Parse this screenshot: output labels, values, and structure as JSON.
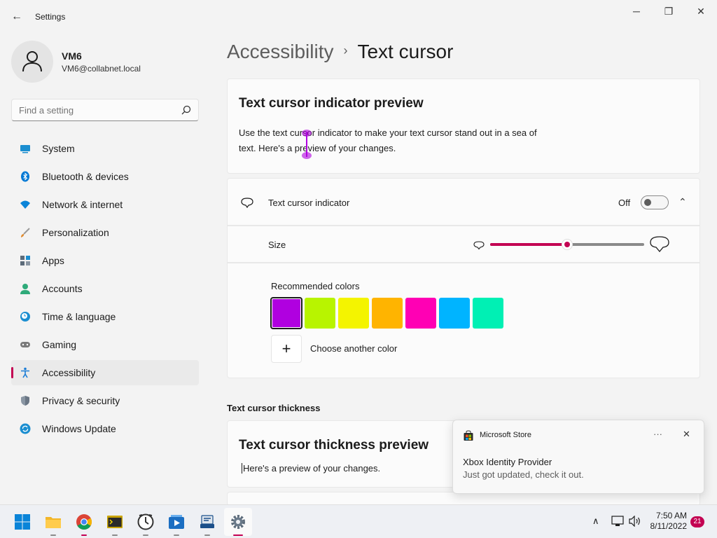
{
  "window": {
    "title": "Settings",
    "back": "←",
    "minimize": "─",
    "maximize": "❐",
    "close": "✕"
  },
  "profile": {
    "name": "VM6",
    "email": "VM6@collabnet.local"
  },
  "search": {
    "placeholder": "Find a setting"
  },
  "nav": [
    {
      "label": "System",
      "icon": "system-icon",
      "color": "#0078d4"
    },
    {
      "label": "Bluetooth & devices",
      "icon": "bluetooth-icon",
      "color": "#0078d4"
    },
    {
      "label": "Network & internet",
      "icon": "wifi-icon",
      "color": "#0a84d8"
    },
    {
      "label": "Personalization",
      "icon": "brush-icon",
      "color": "#e08a2e"
    },
    {
      "label": "Apps",
      "icon": "apps-icon",
      "color": "#5c6b7a"
    },
    {
      "label": "Accounts",
      "icon": "person-icon",
      "color": "#2eaa79"
    },
    {
      "label": "Time & language",
      "icon": "clock-globe-icon",
      "color": "#1b8ed0"
    },
    {
      "label": "Gaming",
      "icon": "gamepad-icon",
      "color": "#7a7a7a"
    },
    {
      "label": "Accessibility",
      "icon": "accessibility-icon",
      "color": "#1b7dd6",
      "active": true
    },
    {
      "label": "Privacy & security",
      "icon": "shield-icon",
      "color": "#7a8694"
    },
    {
      "label": "Windows Update",
      "icon": "update-icon",
      "color": "#1b8ed0"
    }
  ],
  "breadcrumb": {
    "parent": "Accessibility",
    "separator": "›",
    "current": "Text cursor"
  },
  "preview_card": {
    "title": "Text cursor indicator preview",
    "text": "Use the text cursor indicator to make your text cursor stand out in a sea of text. Here's a preview of your changes."
  },
  "indicator": {
    "label": "Text cursor indicator",
    "state": "Off",
    "collapse_glyph": "⌃"
  },
  "size": {
    "label": "Size",
    "value": 0.5
  },
  "colors": {
    "label": "Recommended colors",
    "swatches": [
      "#b000e0",
      "#b8f400",
      "#f4f400",
      "#ffb400",
      "#ff00b4",
      "#00b4ff",
      "#00f0b4"
    ],
    "selected_index": 0,
    "add_glyph": "+",
    "add_label": "Choose another color"
  },
  "thickness": {
    "section_title": "Text cursor thickness",
    "card_title": "Text cursor thickness preview",
    "text": "Here's a preview of your changes."
  },
  "toast": {
    "app": "Microsoft Store",
    "more": "···",
    "close": "✕",
    "title": "Xbox Identity Provider",
    "body": "Just got updated, check it out."
  },
  "taskbar": {
    "apps": [
      {
        "name": "start-icon"
      },
      {
        "name": "file-explorer-icon"
      },
      {
        "name": "chrome-icon",
        "running": true
      },
      {
        "name": "terminal-icon",
        "running": true
      },
      {
        "name": "clock-app-icon",
        "running": true
      },
      {
        "name": "media-player-icon",
        "running": true
      },
      {
        "name": "network-app-icon",
        "running": true
      },
      {
        "name": "settings-icon",
        "running": true,
        "active": true
      }
    ],
    "tray_chevron": "∧",
    "time": "7:50 AM",
    "date": "8/11/2022",
    "notifications": "21"
  }
}
